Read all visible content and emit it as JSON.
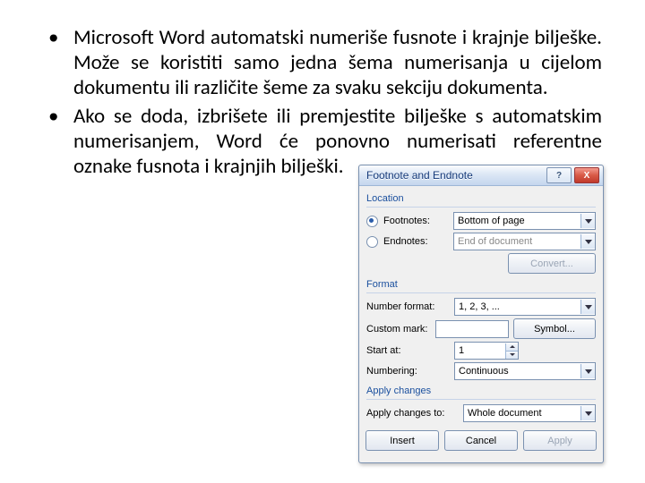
{
  "bullets": [
    "Microsoft Word automatski numeriše fusnote i krajnje bilješke. Može se koristiti samo jedna šema numerisanja u cijelom dokumentu ili različite šeme za svaku sekciju dokumenta.",
    "Ako se doda, izbrišete ili premjestite bilješke s automatskim numerisanjem, Word će ponovno numerisati referentne oznake fusnota i krajnjih bilješki."
  ],
  "dialog": {
    "title": "Footnote and Endnote",
    "groups": {
      "location": "Location",
      "format": "Format",
      "apply_changes": "Apply changes"
    },
    "location": {
      "footnotes_label": "Footnotes:",
      "endnotes_label": "Endnotes:",
      "footnotes_value": "Bottom of page",
      "endnotes_value": "End of document",
      "convert_btn": "Convert..."
    },
    "format": {
      "number_format_label": "Number format:",
      "number_format_value": "1, 2, 3, ...",
      "custom_mark_label": "Custom mark:",
      "symbol_btn": "Symbol...",
      "start_at_label": "Start at:",
      "start_at_value": "1",
      "numbering_label": "Numbering:",
      "numbering_value": "Continuous"
    },
    "apply": {
      "apply_to_label": "Apply changes to:",
      "apply_to_value": "Whole document"
    },
    "buttons": {
      "insert": "Insert",
      "cancel": "Cancel",
      "apply": "Apply"
    }
  }
}
